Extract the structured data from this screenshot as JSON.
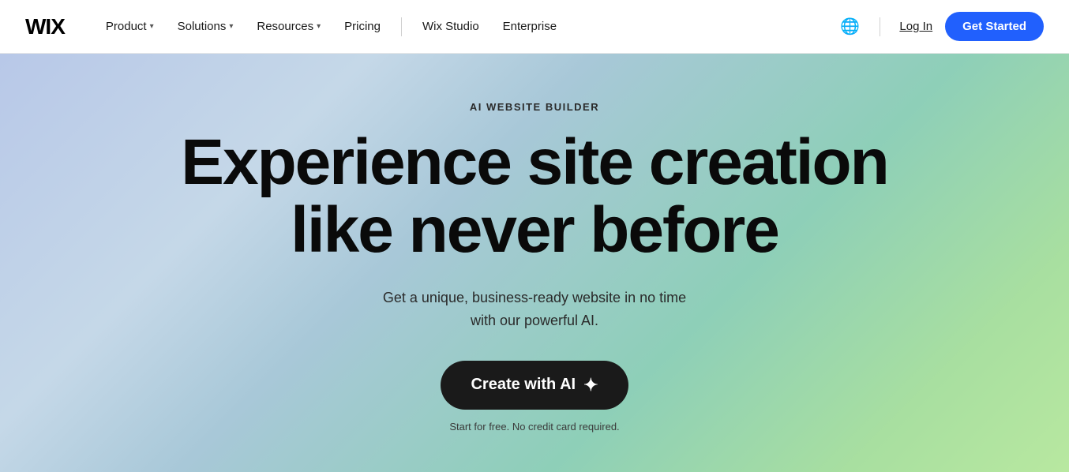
{
  "navbar": {
    "logo": "WIX",
    "nav_items": [
      {
        "label": "Product",
        "has_dropdown": true
      },
      {
        "label": "Solutions",
        "has_dropdown": true
      },
      {
        "label": "Resources",
        "has_dropdown": true
      },
      {
        "label": "Pricing",
        "has_dropdown": false
      },
      {
        "label": "Wix Studio",
        "has_dropdown": false
      },
      {
        "label": "Enterprise",
        "has_dropdown": false
      }
    ],
    "login_label": "Log In",
    "get_started_label": "Get Started"
  },
  "hero": {
    "eyebrow": "AI WEBSITE BUILDER",
    "headline_line1": "Experience site creation",
    "headline_line2": "like never before",
    "subheadline": "Get a unique, business-ready website in no time with our powerful AI.",
    "cta_label": "Create with AI",
    "cta_sparkle": "✦",
    "footnote": "Start for free. No credit card required."
  },
  "icons": {
    "globe": "🌐",
    "chevron_down": "▾",
    "sparkle": "✦"
  }
}
